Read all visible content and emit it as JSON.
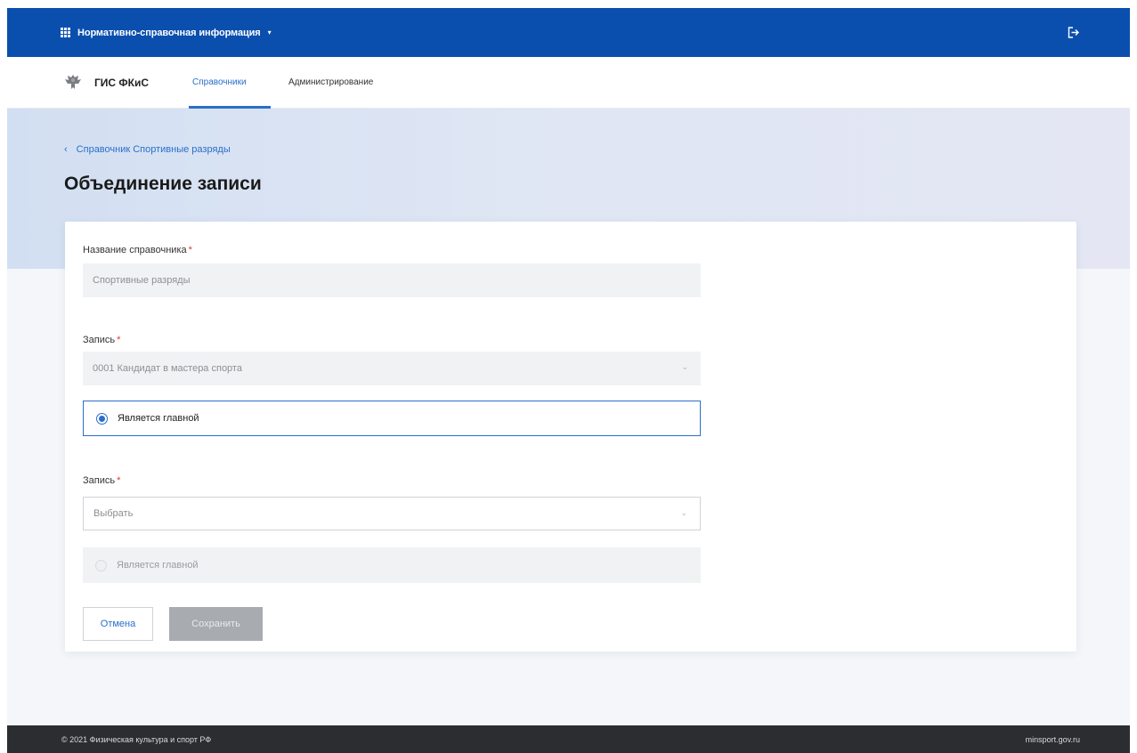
{
  "topbar": {
    "app_title": "Нормативно-справочная информация",
    "app_chevron": "▾",
    "accent": "#0a4fae"
  },
  "navbar": {
    "brand": "ГИС ФКиС",
    "tabs": [
      {
        "label": "Справочники",
        "active": true
      },
      {
        "label": "Администрирование",
        "active": false
      }
    ]
  },
  "page": {
    "breadcrumb": "Справочник Спортивные разряды",
    "back_glyph": "‹",
    "title": "Объединение записи"
  },
  "form": {
    "dictionary_label": "Название справочника",
    "dictionary_value": "Спортивные разряды",
    "record1_label": "Запись",
    "record1_value": "0001 Кандидат в мастера спорта",
    "record1_main_label": "Является главной",
    "record2_label": "Запись",
    "record2_placeholder": "Выбрать",
    "record2_main_label": "Является главной",
    "required_mark": "*",
    "caret": "⌄"
  },
  "buttons": {
    "cancel": "Отмена",
    "save": "Сохранить"
  },
  "footer": {
    "copyright": "© 2021 Физическая культура и спорт РФ",
    "site": "minsport.gov.ru"
  }
}
